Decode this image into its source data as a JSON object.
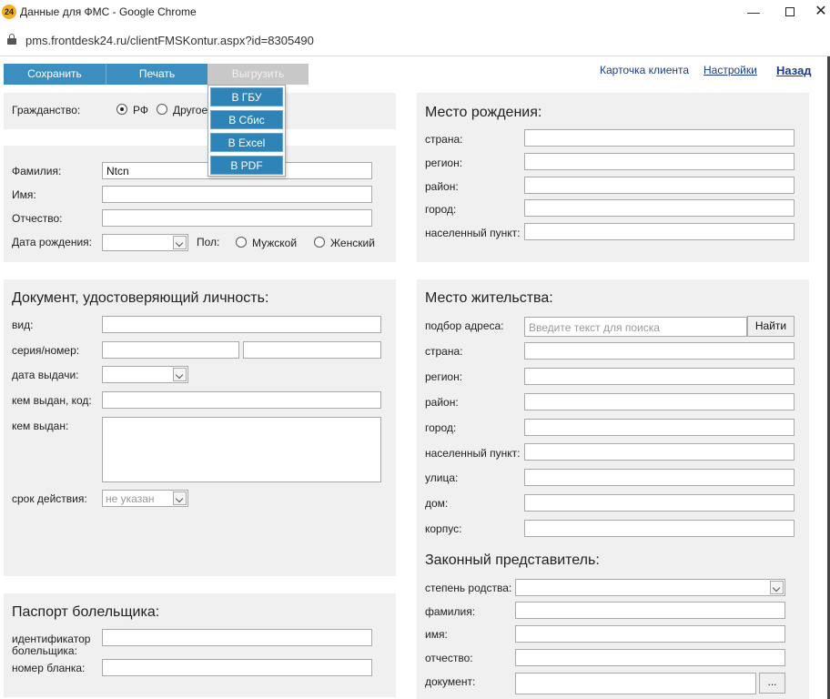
{
  "window": {
    "app_badge": "24",
    "title": "Данные для ФМС - Google Chrome",
    "url": "pms.frontdesk24.ru/clientFMSKontur.aspx?id=8305490"
  },
  "toolbar": {
    "save": "Сохранить",
    "print": "Печать",
    "export": "Выгрузить",
    "export_menu": [
      "В ГБУ",
      "В Сбис",
      "В Excel",
      "В PDF"
    ],
    "links": {
      "client_card": "Карточка клиента",
      "settings": "Настройки",
      "back": "Назад"
    }
  },
  "citizenship": {
    "label": "Гражданство:",
    "options": [
      "РФ",
      "Другое"
    ],
    "selected": "РФ"
  },
  "person": {
    "surname_label": "Фамилия:",
    "surname_value": "Ntcn",
    "name_label": "Имя:",
    "patronymic_label": "Отчество:",
    "birthdate_label": "Дата рождения:",
    "gender_label": "Пол:",
    "gender_options": [
      "Мужской",
      "Женский"
    ]
  },
  "birthplace": {
    "title": "Место рождения:",
    "fields": [
      "страна:",
      "регион:",
      "район:",
      "город:",
      "населенный пункт:"
    ]
  },
  "document": {
    "title": "Документ, удостоверяющий личность:",
    "type_label": "вид:",
    "series_label": "серия/номер:",
    "issue_date_label": "дата выдачи:",
    "issuer_code_label": "кем выдан, код:",
    "issuer_label": "кем выдан:",
    "validity_label": "срок действия:",
    "validity_value": "не указан"
  },
  "residence": {
    "title": "Место жительства:",
    "search_label": "подбор адреса:",
    "search_placeholder": "Введите текст для поиска",
    "search_button": "Найти",
    "fields": [
      "страна:",
      "регион:",
      "район:",
      "город:",
      "населенный пункт:",
      "улица:",
      "дом:",
      "корпус:"
    ]
  },
  "fan_passport": {
    "title": "Паспорт болельщика:",
    "id_label_line1": "идентификатор",
    "id_label_line2": "болельщика:",
    "form_number_label": "номер бланка:"
  },
  "representative": {
    "title": "Законный представитель:",
    "relation_label": "степень родства:",
    "fields": [
      "фамилия:",
      "имя:",
      "отчество:",
      "документ:"
    ],
    "doc_button": "..."
  }
}
